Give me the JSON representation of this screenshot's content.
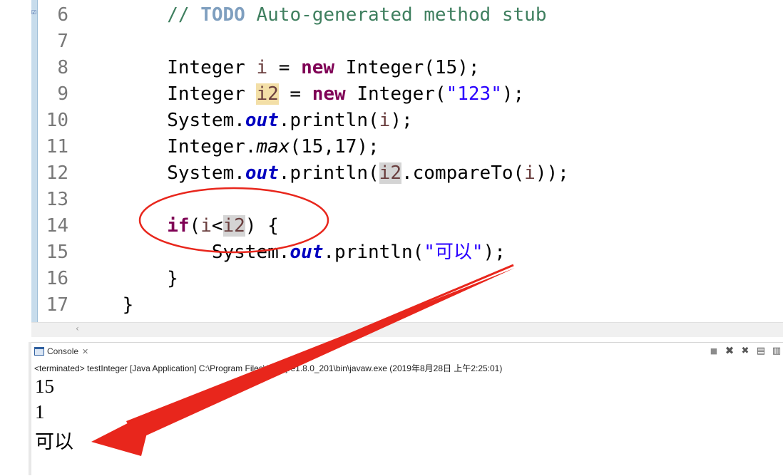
{
  "editor": {
    "lines": [
      {
        "num": "6",
        "tokens": [
          {
            "t": "        ",
            "c": ""
          },
          {
            "t": "// ",
            "c": "cmt"
          },
          {
            "t": "TODO",
            "c": "task"
          },
          {
            "t": " Auto-generated method stub",
            "c": "cmt"
          }
        ]
      },
      {
        "num": "7",
        "tokens": []
      },
      {
        "num": "8",
        "tokens": [
          {
            "t": "        Integer ",
            "c": ""
          },
          {
            "t": "i",
            "c": "var"
          },
          {
            "t": " = ",
            "c": ""
          },
          {
            "t": "new",
            "c": "kw"
          },
          {
            "t": " Integer(15);",
            "c": ""
          }
        ]
      },
      {
        "num": "9",
        "tokens": [
          {
            "t": "        Integer ",
            "c": ""
          },
          {
            "t": "i2",
            "c": "var occw"
          },
          {
            "t": " = ",
            "c": ""
          },
          {
            "t": "new",
            "c": "kw"
          },
          {
            "t": " Integer(",
            "c": ""
          },
          {
            "t": "\"123\"",
            "c": "str"
          },
          {
            "t": ");",
            "c": ""
          }
        ]
      },
      {
        "num": "10",
        "tokens": [
          {
            "t": "        System.",
            "c": ""
          },
          {
            "t": "out",
            "c": "fld"
          },
          {
            "t": ".println(",
            "c": ""
          },
          {
            "t": "i",
            "c": "var"
          },
          {
            "t": ");",
            "c": ""
          }
        ]
      },
      {
        "num": "11",
        "tokens": [
          {
            "t": "        Integer.",
            "c": ""
          },
          {
            "t": "max",
            "c": "stat"
          },
          {
            "t": "(15,17);",
            "c": ""
          }
        ]
      },
      {
        "num": "12",
        "tokens": [
          {
            "t": "        System.",
            "c": ""
          },
          {
            "t": "out",
            "c": "fld"
          },
          {
            "t": ".println(",
            "c": ""
          },
          {
            "t": "i2",
            "c": "var occ"
          },
          {
            "t": ".compareTo(",
            "c": ""
          },
          {
            "t": "i",
            "c": "var"
          },
          {
            "t": "));",
            "c": ""
          }
        ]
      },
      {
        "num": "13",
        "tokens": []
      },
      {
        "num": "14",
        "tokens": [
          {
            "t": "        ",
            "c": ""
          },
          {
            "t": "if",
            "c": "kw"
          },
          {
            "t": "(",
            "c": ""
          },
          {
            "t": "i",
            "c": "var"
          },
          {
            "t": "<",
            "c": ""
          },
          {
            "t": "i2",
            "c": "var occ"
          },
          {
            "t": ") {",
            "c": ""
          }
        ]
      },
      {
        "num": "15",
        "tokens": [
          {
            "t": "            System.",
            "c": ""
          },
          {
            "t": "out",
            "c": "fld"
          },
          {
            "t": ".println(",
            "c": ""
          },
          {
            "t": "\"可以\"",
            "c": "str"
          },
          {
            "t": ");",
            "c": ""
          }
        ]
      },
      {
        "num": "16",
        "tokens": [
          {
            "t": "        }",
            "c": ""
          }
        ]
      },
      {
        "num": "17",
        "tokens": [
          {
            "t": "    }",
            "c": ""
          }
        ]
      }
    ]
  },
  "console": {
    "tab_label": "Console",
    "close_symbol": "✕",
    "path": "<terminated> testInteger [Java Application] C:\\Program Files\\Java\\jre1.8.0_201\\bin\\javaw.exe (2019年8月28日 上午2:25:01)",
    "output": [
      "15",
      "1",
      "可以"
    ]
  },
  "colors": {
    "keyword": "#7f0055",
    "string": "#2a00ff",
    "comment": "#3f7f5f",
    "field": "#0000c0",
    "annotation_red": "#e8261c"
  }
}
